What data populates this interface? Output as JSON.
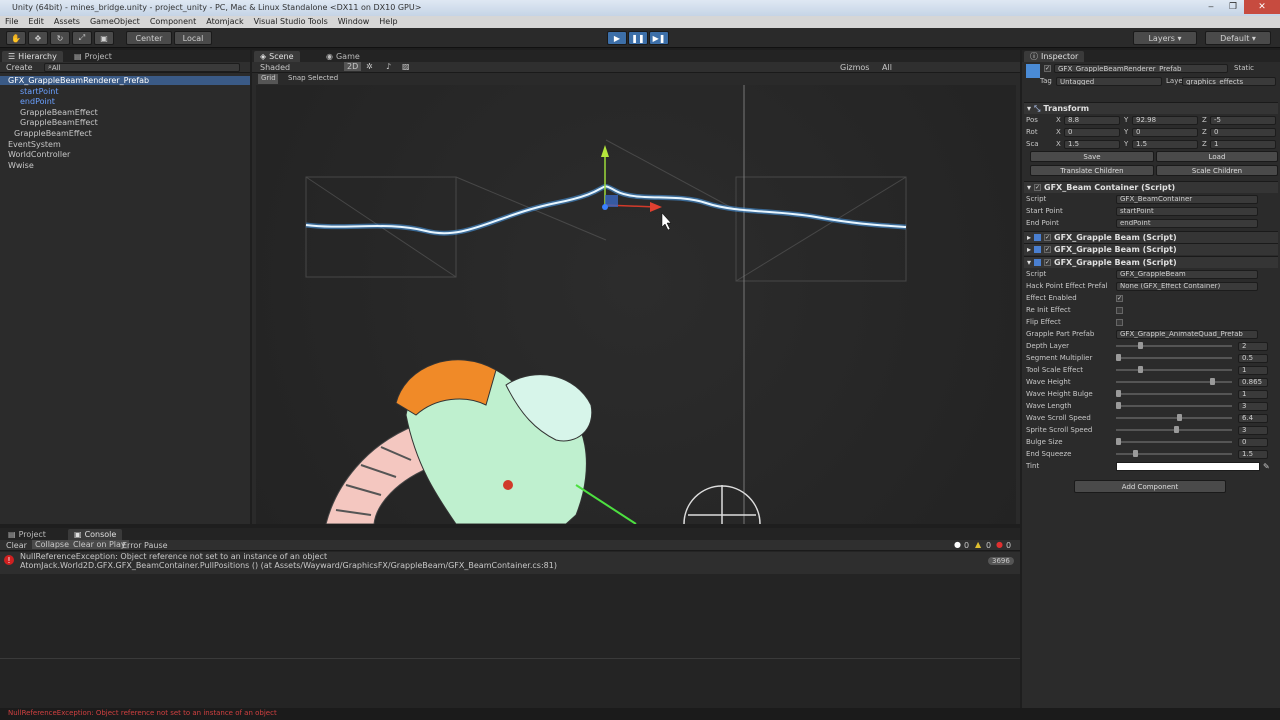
{
  "window": {
    "title": "Unity (64bit) - mines_bridge.unity - project_unity - PC, Mac & Linux Standalone <DX11 on DX10 GPU>",
    "controls": [
      "‒",
      "❐",
      "✕"
    ]
  },
  "menu": [
    "File",
    "Edit",
    "Assets",
    "GameObject",
    "Component",
    "Atomjack",
    "Visual Studio Tools",
    "Window",
    "Help"
  ],
  "toolbar": {
    "pivot": "Center",
    "space": "Local",
    "layers": "Layers",
    "layout": "Default"
  },
  "hierarchy": {
    "tabs": [
      "Hierarchy",
      "Project"
    ],
    "create": "Create",
    "search": "All",
    "items": [
      {
        "label": "GFX_GrappleBeamRenderer_Prefab",
        "indent": 0,
        "selected": true,
        "blue": true
      },
      {
        "label": "startPoint",
        "indent": 2,
        "selected": false,
        "blue": true
      },
      {
        "label": "endPoint",
        "indent": 2,
        "selected": false,
        "blue": true
      },
      {
        "label": "GrappleBeamEffect",
        "indent": 2,
        "selected": false,
        "blue": false
      },
      {
        "label": "GrappleBeamEffect",
        "indent": 2,
        "selected": false,
        "blue": false
      },
      {
        "label": "GrappleBeamEffect",
        "indent": 1,
        "selected": false,
        "blue": false
      },
      {
        "label": "EventSystem",
        "indent": 0,
        "selected": false,
        "blue": false
      },
      {
        "label": "WorldController",
        "indent": 0,
        "selected": false,
        "blue": false
      },
      {
        "label": "Wwise",
        "indent": 0,
        "selected": false,
        "blue": false
      }
    ]
  },
  "scene": {
    "tabs": [
      "Scene",
      "Game"
    ],
    "shading": "Shaded",
    "mode2d": "2D",
    "gizmos": "Gizmos",
    "search": "All",
    "grid": "Grid",
    "snap": "Snap Selected"
  },
  "console": {
    "tabs": [
      "Project",
      "Console"
    ],
    "buttons": [
      "Clear",
      "Collapse",
      "Clear on Play",
      "Error Pause"
    ],
    "counts": {
      "info": "0",
      "warn": "0",
      "error": "0"
    },
    "message_line1": "NullReferenceException: Object reference not set to an instance of an object",
    "message_line2": "AtomJack.World2D.GFX.GFX_BeamContainer.PullPositions () (at Assets/Wayward/GraphicsFX/GrappleBeam/GFX_BeamContainer.cs:81)",
    "repeat_count": "3696"
  },
  "status": "NullReferenceException: Object reference not set to an instance of an object",
  "inspector": {
    "tab": "Inspector",
    "object_name": "GFX_GrappleBeamRenderer_Prefab",
    "static": "Static",
    "tag_label": "Tag",
    "tag": "Untagged",
    "layer_label": "Layer",
    "layer": "graphics_effects",
    "transform": {
      "title": "Transform",
      "pos": {
        "label": "Pos",
        "x": "8.8",
        "y": "92.98",
        "z": "-5"
      },
      "rot": {
        "label": "Rot",
        "x": "0",
        "y": "0",
        "z": "0"
      },
      "sca": {
        "label": "Sca",
        "x": "1.5",
        "y": "1.5",
        "z": "1"
      },
      "save": "Save",
      "load": "Load",
      "translate": "Translate Children",
      "scale": "Scale Children"
    },
    "beam_container": {
      "title": "GFX_Beam Container (Script)",
      "rows": [
        {
          "label": "Script",
          "value": "GFX_BeamContainer"
        },
        {
          "label": "Start Point",
          "value": "startPoint"
        },
        {
          "label": "End Point",
          "value": "endPoint"
        }
      ]
    },
    "grapple_beam_titles": [
      "GFX_Grapple Beam (Script)",
      "GFX_Grapple Beam (Script)",
      "GFX_Grapple Beam (Script)"
    ],
    "grapple_beam": {
      "script_label": "Script",
      "script": "GFX_GrappleBeam",
      "hack_label": "Hack Point Effect Prefal",
      "hack_value": "None (GFX_Effect Container)",
      "effect_enabled": "Effect Enabled",
      "re_init": "Re Init Effect",
      "flip": "Flip Effect",
      "part_label": "Grapple Part Prefab",
      "part_value": "GFX_Grapple_AnimateQuad_Prefab",
      "sliders": [
        {
          "label": "Depth Layer",
          "value": "2",
          "frac": 0.2
        },
        {
          "label": "Segment Multiplier",
          "value": "0.5",
          "frac": 0.0
        },
        {
          "label": "Tool Scale Effect",
          "value": "1",
          "frac": 0.2
        },
        {
          "label": "Wave Height",
          "value": "0.865",
          "frac": 0.85
        },
        {
          "label": "Wave Height Bulge",
          "value": "1",
          "frac": 0.0
        },
        {
          "label": "Wave Length",
          "value": "3",
          "frac": 0.0
        },
        {
          "label": "Wave Scroll Speed",
          "value": "6.4",
          "frac": 0.55
        },
        {
          "label": "Sprite Scroll Speed",
          "value": "3",
          "frac": 0.52
        },
        {
          "label": "Bulge Size",
          "value": "0",
          "frac": 0.0
        },
        {
          "label": "End Squeeze",
          "value": "1.5",
          "frac": 0.15
        }
      ],
      "tint": "Tint"
    },
    "add_component": "Add Component"
  }
}
